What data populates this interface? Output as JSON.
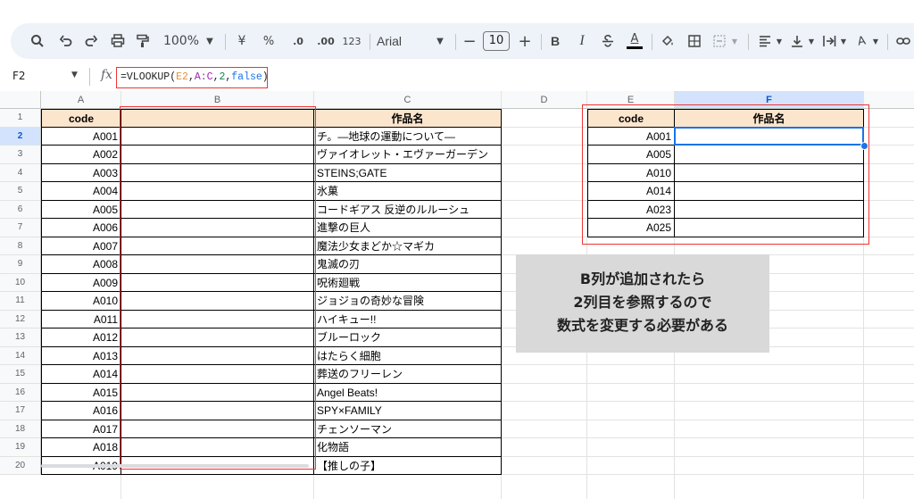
{
  "toolbar": {
    "zoom": "100%",
    "currency": "¥",
    "percent": "%",
    "dec_decrease": ".0",
    "dec_increase": ".00",
    "format_123": "123",
    "font": "Arial",
    "font_size": "10",
    "minus": "−",
    "plus": "+",
    "bold": "B",
    "italic": "I",
    "text_color": "A",
    "highlight": "A"
  },
  "formula_bar": {
    "name_box": "F2",
    "fx": "fx",
    "formula_prefix": "=VLOOKUP(",
    "arg1": "E2",
    "comma1": ",",
    "arg2": "A:C",
    "comma2": ",",
    "arg3": "2",
    "comma3": ",",
    "arg4": "false",
    "formula_suffix": ")"
  },
  "columns": [
    "A",
    "B",
    "C",
    "D",
    "E",
    "F"
  ],
  "rows": [
    "1",
    "2",
    "3",
    "4",
    "5",
    "6",
    "7",
    "8",
    "9",
    "10",
    "11",
    "12",
    "13",
    "14",
    "15",
    "16",
    "17",
    "18",
    "19",
    "20"
  ],
  "table_left": {
    "header_code": "code",
    "header_title": "作品名",
    "codes": [
      "A001",
      "A002",
      "A003",
      "A004",
      "A005",
      "A006",
      "A007",
      "A008",
      "A009",
      "A010",
      "A011",
      "A012",
      "A013",
      "A014",
      "A015",
      "A016",
      "A017",
      "A018",
      "A019"
    ],
    "titles": [
      "チ。―地球の運動について―",
      "ヴァイオレット・エヴァーガーデン",
      "STEINS;GATE",
      "氷菓",
      "コードギアス 反逆のルルーシュ",
      "進撃の巨人",
      "魔法少女まどか☆マギカ",
      "鬼滅の刃",
      "呪術廻戦",
      "ジョジョの奇妙な冒険",
      "ハイキュー!!",
      "ブルーロック",
      "はたらく細胞",
      "葬送のフリーレン",
      "Angel Beats!",
      "SPY×FAMILY",
      "チェンソーマン",
      "化物語",
      "【推しの子】"
    ]
  },
  "table_right": {
    "header_code": "code",
    "header_title": "作品名",
    "codes": [
      "A001",
      "A005",
      "A010",
      "A014",
      "A023",
      "A025"
    ]
  },
  "note": {
    "line1": "B列が追加されたら",
    "line2": "2列目を参照するので",
    "line3": "数式を変更する必要がある"
  },
  "colors": {
    "header_fill": "#fbe5cd",
    "selection_blue": "#1a73e8",
    "annotation_red": "#ee3333",
    "note_bg": "#d9d9d9"
  }
}
